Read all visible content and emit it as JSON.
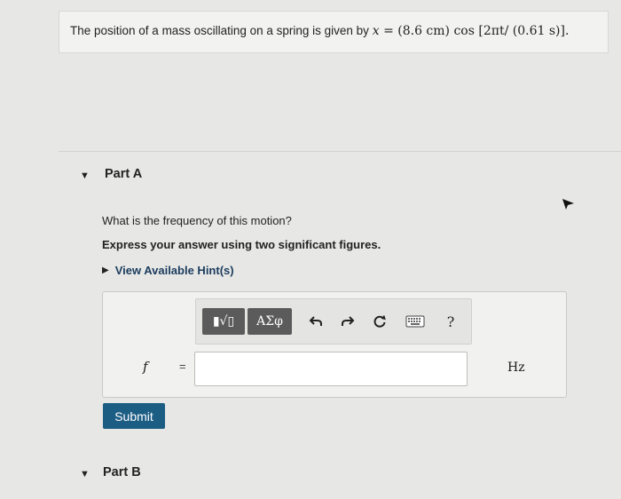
{
  "problem": {
    "text_prefix": "The position of a mass oscillating on a spring is given by",
    "equation_var": "x",
    "equation_eq": "=",
    "equation_rhs_amp": "(8.6 cm)",
    "equation_cos": "cos",
    "equation_arg": "[2πt/ (0.61 s)]",
    "end_punct": "."
  },
  "part_a": {
    "label": "Part A",
    "question": "What is the frequency of this motion?",
    "instruction": "Express your answer using two significant figures.",
    "hint_label": "View Available Hint(s)",
    "toolbar": {
      "templates_label": "▮√▯",
      "symbols_label": "ΑΣφ",
      "undo_icon": "undo-icon",
      "redo_icon": "redo-icon",
      "reset_icon": "reset-icon",
      "keyboard_icon": "keyboard-icon",
      "help_label": "?"
    },
    "variable": "f",
    "equals": "=",
    "answer_value": "",
    "unit": "Hz",
    "submit_label": "Submit"
  },
  "part_b": {
    "label": "Part B"
  },
  "colors": {
    "submit_bg": "#1c5d84",
    "hint_text": "#1b3c5e",
    "toolbar_dark": "#5b5b5b"
  }
}
